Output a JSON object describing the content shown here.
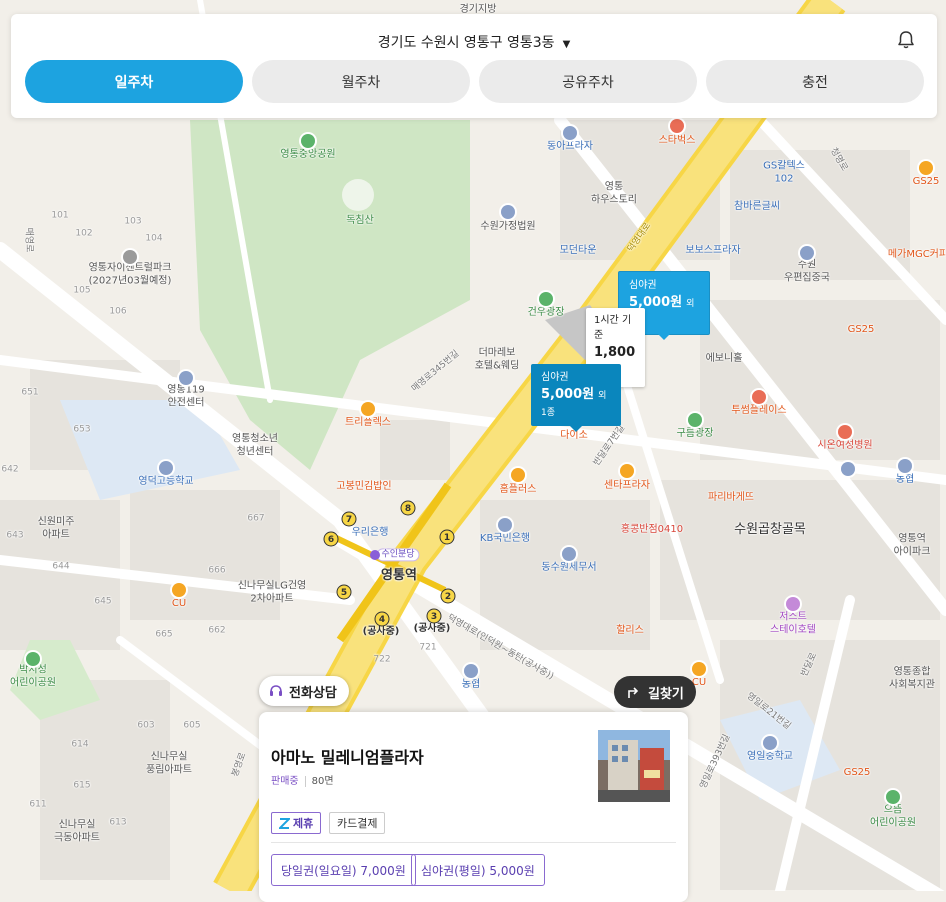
{
  "header": {
    "location": "경기도 수원시 영통구 영통3동",
    "caret": "▼",
    "tabs": [
      {
        "label": "일주차",
        "active": true
      },
      {
        "label": "월주차",
        "active": false
      },
      {
        "label": "공유주차",
        "active": false
      },
      {
        "label": "충전",
        "active": false
      }
    ]
  },
  "colors": {
    "accent": "#1da3e0",
    "marker_dark": "#0a86bd",
    "purple": "#7a4fc4",
    "road_main": "#f7d646"
  },
  "map": {
    "labels": {
      "l1": "영통중앙공원",
      "l2": "독침산",
      "l3": "영통자이센트럴파크\n(2027년03월예정)",
      "l4": "동아프라자",
      "l5": "스타벅스",
      "l6": "GS칼텍스\n102",
      "l7": "GS25",
      "l8": "영통\n하우스토리",
      "l9": "참바른글씨",
      "l10": "수원가정법원",
      "l11": "모던타운",
      "l12": "보보스프라자",
      "l13": "수원\n우편집중국",
      "l14": "메가MGC커피",
      "l15": "건우광장",
      "l16": "더마레보\n호텔&웨딩",
      "l17": "GS25",
      "l18": "에보니홀",
      "l19": "영통119\n안전센터",
      "l20": "영통청소년\n청년센터",
      "l21": "트리플렉스",
      "l22": "다이소",
      "l23": "투썸플레이스",
      "l24": "구름광장",
      "l25": "시온여성병원",
      "l26": "영덕고등학교",
      "l27": "고봉민김밥인",
      "l28": "홈플러스",
      "l29": "센타프라자",
      "l30": "파리바게뜨",
      "l31": "농협",
      "l32": "신원미주\n아파트",
      "l33": "우리은행",
      "l34": "수인분당",
      "l35": "영통역",
      "l36": "KB국민은행",
      "l37": "홍콩반점0410",
      "l38": "수원곱창골목",
      "l39": "영통역\n아이파크",
      "l40": "신나무실LG건영\n2차아파트",
      "l41": "CU",
      "l42": "동수원세무서",
      "l43": "(공사중)",
      "l44": "(공사중)",
      "l45": "할리스",
      "l46": "저스트\n스테이호텔",
      "l47": "박지성\n어린이공원",
      "l48": "농협",
      "l49": "CU",
      "l50": "영통종합\n사회복지관",
      "l51": "신나무실\n풍림아파트",
      "l52": "영일중학교",
      "l53": "GS25",
      "l54": "신나무실\n극동아파트",
      "l55": "으뜸\n어린이공원",
      "l56": "청명로",
      "l57": "봉영로",
      "l58": "덕영대로",
      "l59": "매영로",
      "l60": "매영로345번길",
      "l61": "반달로7번길",
      "l62": "영일로21번길",
      "l63": "영일로393번길",
      "l64": "반달로",
      "l65": "덕영대로(인덕원~동탄(공사중))",
      "l66": "경기지방"
    },
    "numbers": [
      "101",
      "102",
      "103",
      "104",
      "105",
      "106",
      "107",
      "651",
      "652",
      "653",
      "654",
      "655",
      "642",
      "643",
      "644",
      "645",
      "666",
      "667",
      "662",
      "665",
      "722",
      "721",
      "603",
      "604",
      "605",
      "611",
      "613",
      "614",
      "615",
      "70",
      "724"
    ]
  },
  "markers": [
    {
      "title": "심야권",
      "price": "5,000원",
      "extra": "외 1종"
    },
    {
      "title": "1시간 기준",
      "price": "1,800원"
    },
    {
      "title": "심야권",
      "price": "5,000원",
      "extra": "외 1종"
    }
  ],
  "subway_exits": [
    "1",
    "2",
    "3",
    "4",
    "5",
    "6",
    "7",
    "8"
  ],
  "buttons": {
    "call": "전화상담",
    "navigate": "길찾기"
  },
  "card": {
    "title": "아마노 밀레니엄플라자",
    "status": "판매중",
    "spaces": "80면",
    "tags": [
      "제휴",
      "카드결제"
    ],
    "tickets": [
      "당일권(일요일) 7,000원",
      "심야권(평일) 5,000원"
    ]
  }
}
